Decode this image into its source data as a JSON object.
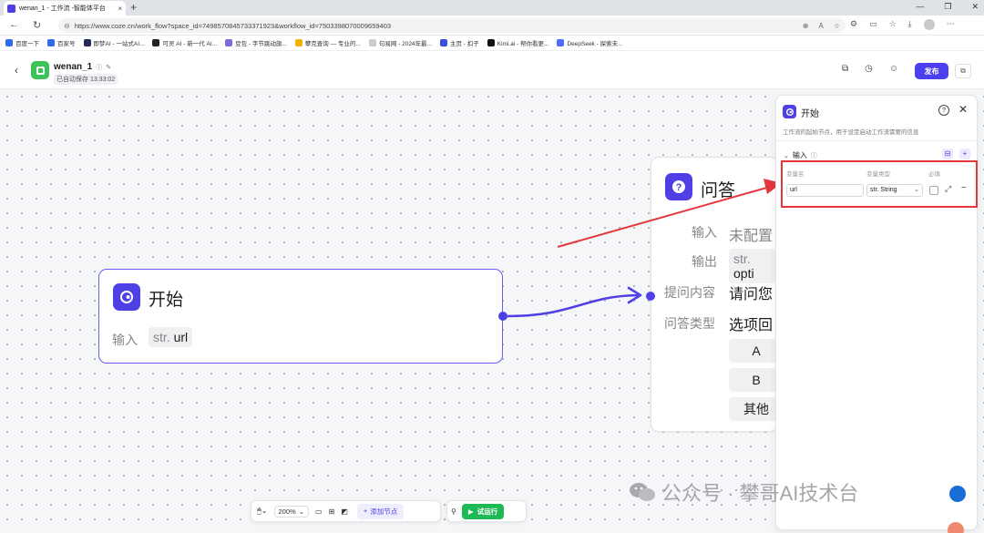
{
  "browser": {
    "tab_title": "wenan_1 - 工作流 -智能体平台",
    "tab_close": "×",
    "new_tab": "+",
    "url": "https://www.coze.cn/work_flow?space_id=7498570845733371923&workflow_id=7503398070009659403",
    "bookmarks": [
      {
        "label": "百度一下",
        "color": "#2f6ce5"
      },
      {
        "label": "百家号",
        "color": "#2f6ce5"
      },
      {
        "label": "即梦AI - 一站式AI...",
        "color": "#1e2a5a"
      },
      {
        "label": "可灵 AI - 新一代 AI...",
        "color": "#222222"
      },
      {
        "label": "豆包 - 字节跳动旗...",
        "color": "#7a6bd8"
      },
      {
        "label": "攀克查询 — 专业的...",
        "color": "#f0b400"
      },
      {
        "label": "句易网 - 2024年最...",
        "color": "#cccccc"
      },
      {
        "label": "主页 - 扣子",
        "color": "#3b4ee0"
      },
      {
        "label": "Kimi.ai - 帮你看更...",
        "color": "#111111"
      },
      {
        "label": "DeepSeek - 探索未...",
        "color": "#4d6bfe"
      }
    ]
  },
  "app": {
    "name": "wenan_1",
    "saved": "已自动保存 13:33:02",
    "publish": "发布"
  },
  "canvas": {
    "start_node": {
      "title": "开始",
      "input_label": "输入",
      "input_type": "str.",
      "input_name": "url"
    },
    "qa_node": {
      "title": "问答",
      "input_label": "输入",
      "input_value": "未配置",
      "output_label": "输出",
      "output_type": "str.",
      "output_value": "opti",
      "question_label": "提问内容",
      "question_value": "请问您",
      "answer_type_label": "问答类型",
      "answer_type_value": "选项回",
      "options": [
        "A",
        "B",
        "其他"
      ]
    }
  },
  "panel": {
    "title": "开始",
    "description": "工作流的起始节点，用于设定启动工作流需要的信息",
    "section_label": "输入",
    "col_name": "变量名",
    "col_type": "变量类型",
    "col_required": "必填",
    "variable": {
      "name": "url",
      "type": "str. String"
    }
  },
  "toolbar": {
    "zoom": "200%",
    "add_node": "添加节点",
    "run": "试运行"
  },
  "watermark": {
    "text": "公众号 · 攀哥AI技术台"
  },
  "colors": {
    "accent": "#4e40e5",
    "publish": "#4c3ff0",
    "run": "#1db954",
    "highlight": "#e4373c"
  }
}
